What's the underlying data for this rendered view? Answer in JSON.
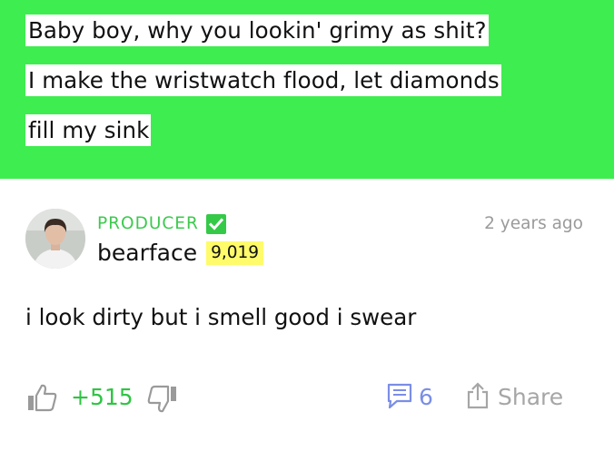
{
  "lyric": {
    "lines": [
      "Baby boy, why you lookin' grimy as shit?",
      "I make the wristwatch flood, let diamonds",
      "fill my sink"
    ]
  },
  "comment": {
    "author": {
      "role": "PRODUCER",
      "username": "bearface",
      "iq": "9,019",
      "verified_icon": "check-icon"
    },
    "timestamp": "2 years ago",
    "body": "i look dirty but i smell good i swear",
    "actions": {
      "upvote_icon": "thumbs-up-icon",
      "votes": "+515",
      "downvote_icon": "thumbs-down-icon",
      "comments_icon": "speech-bubble-icon",
      "comments_count": "6",
      "share_icon": "share-icon",
      "share_label": "Share"
    }
  },
  "colors": {
    "banner_green": "#3eed4f",
    "accent_green": "#3dc94f",
    "iq_yellow": "#fffb6a",
    "comment_blue": "#7a8ee6",
    "muted_gray": "#9a9a9a"
  }
}
